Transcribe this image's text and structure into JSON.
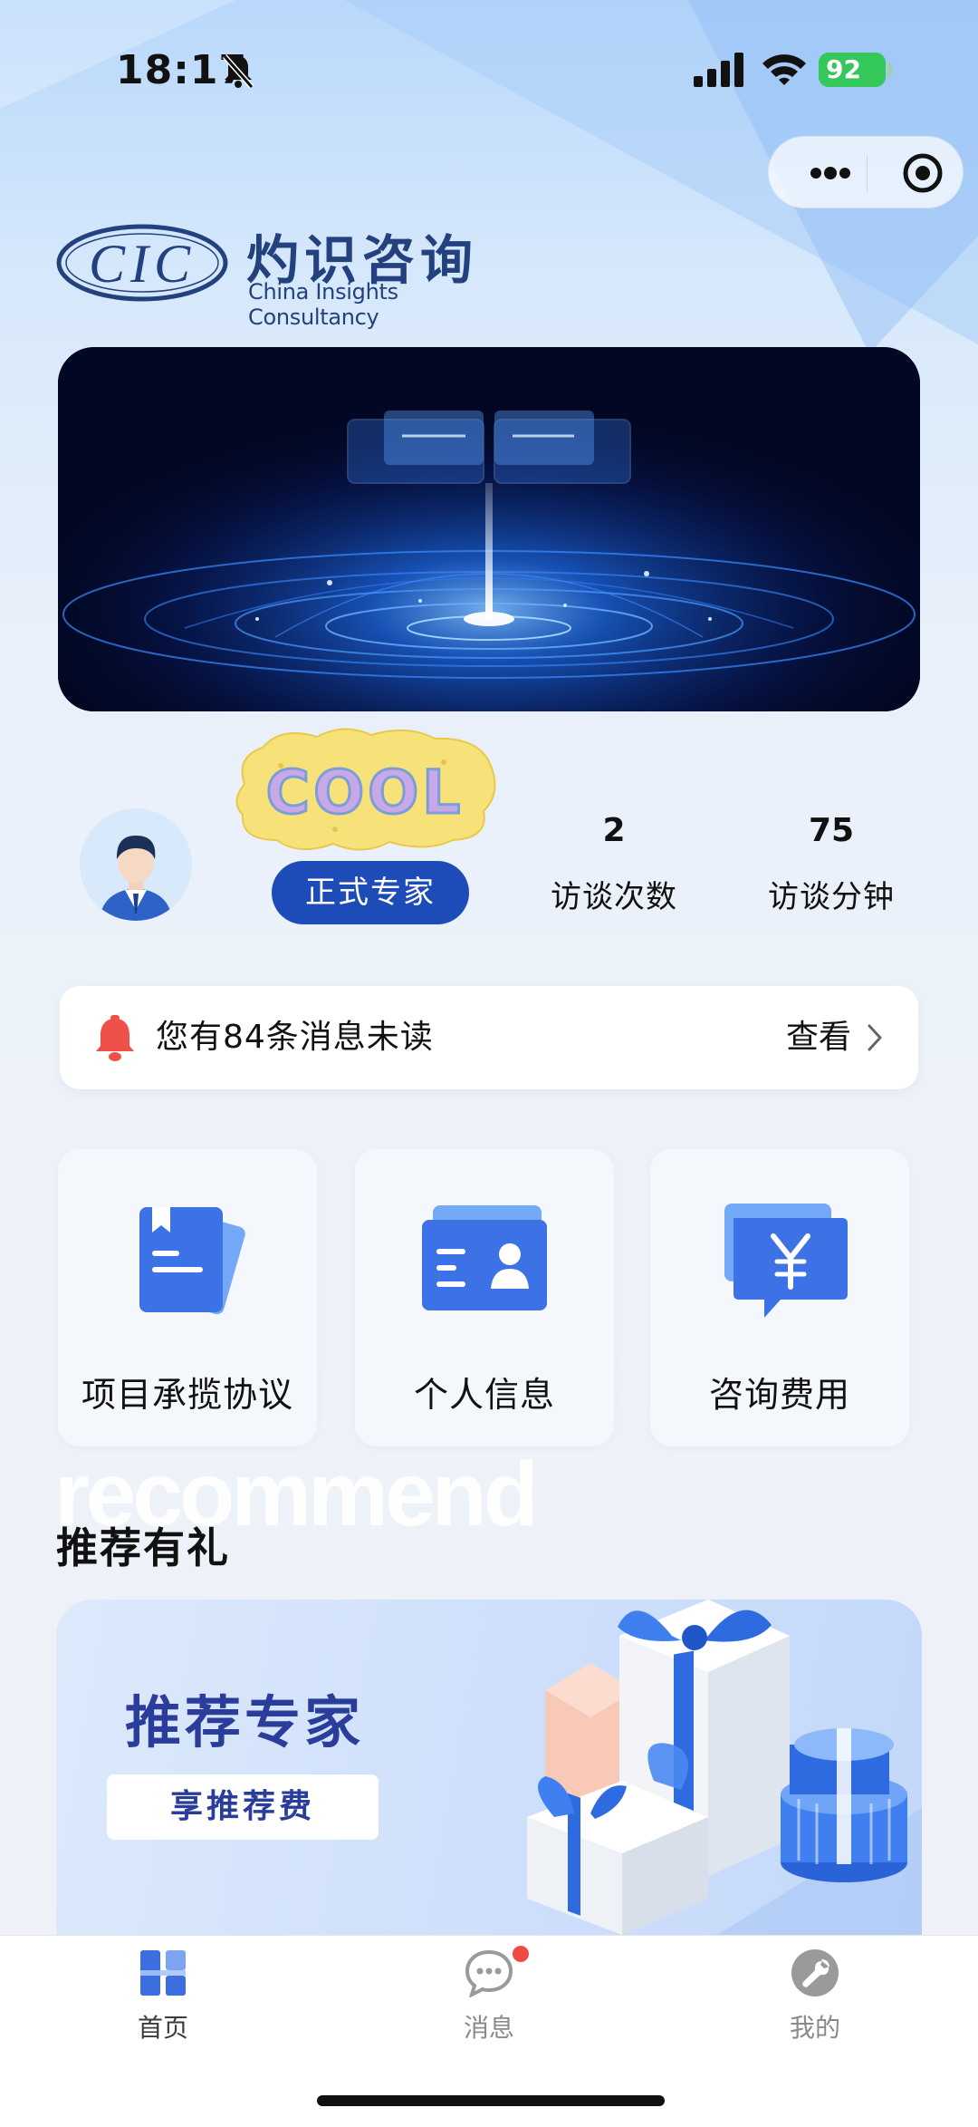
{
  "status_bar": {
    "time": "18:17",
    "battery": "92"
  },
  "logo": {
    "mark": "CIC",
    "name_cn": "灼识咨询",
    "name_en": "China Insights Consultancy"
  },
  "profile": {
    "badge_text": "COOL",
    "role_tag": "正式专家",
    "stats": [
      {
        "value": "2",
        "label": "访谈次数"
      },
      {
        "value": "75",
        "label": "访谈分钟"
      }
    ]
  },
  "notification": {
    "text": "您有84条消息未读",
    "action": "查看"
  },
  "tiles": [
    {
      "label": "项目承揽协议",
      "icon": "agreement-icon"
    },
    {
      "label": "个人信息",
      "icon": "id-card-icon"
    },
    {
      "label": "咨询费用",
      "icon": "fee-icon"
    }
  ],
  "recommend": {
    "watermark": "recommend",
    "title": "推荐有礼",
    "promo_title": "推荐专家",
    "promo_button": "享推荐费"
  },
  "tabbar": {
    "active_color": "#3b6fe0",
    "inactive_color": "#8a8a8a",
    "items": [
      {
        "label": "首页",
        "icon": "home-grid-icon",
        "active": true
      },
      {
        "label": "消息",
        "icon": "chat-bubble-icon",
        "active": false,
        "has_badge": true
      },
      {
        "label": "我的",
        "icon": "wrench-icon",
        "active": false
      }
    ]
  }
}
